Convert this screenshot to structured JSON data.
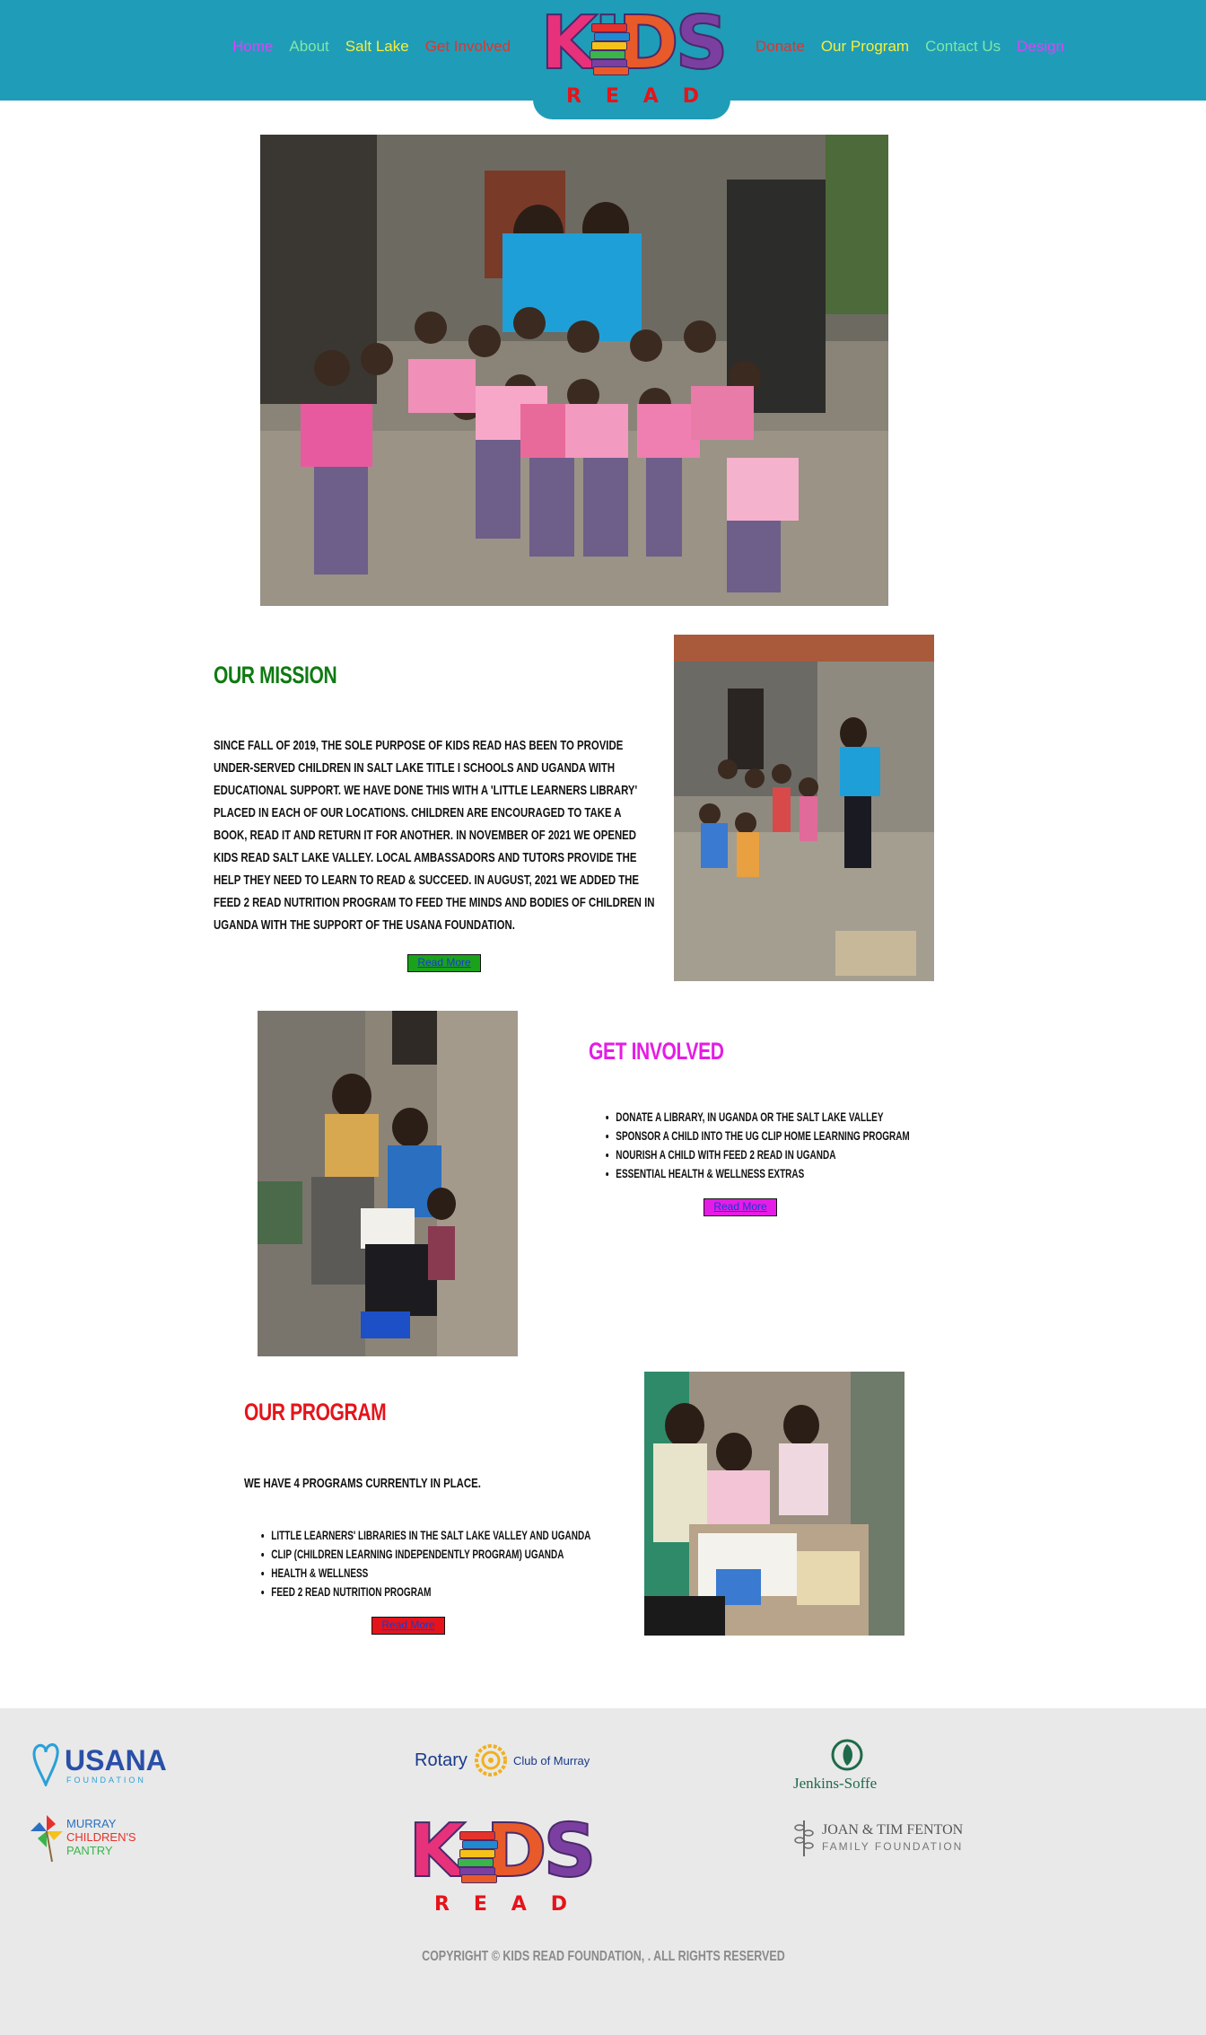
{
  "header": {
    "nav_left": [
      {
        "label": "Home",
        "color": "#e040fb"
      },
      {
        "label": "About",
        "color": "#7ee8a6"
      },
      {
        "label": "Salt Lake",
        "color": "#f5ef3a"
      },
      {
        "label": "Get Involved",
        "color": "#e5322b"
      }
    ],
    "nav_right": [
      {
        "label": "Donate",
        "color": "#e5322b"
      },
      {
        "label": "Our Program",
        "color": "#f5ef3a"
      },
      {
        "label": "Contact Us",
        "color": "#7ee8a6"
      },
      {
        "label": "Design",
        "color": "#e040fb"
      }
    ],
    "logo": {
      "word": "KIDS",
      "sub": "READ",
      "icon": "book-stack-icon"
    }
  },
  "mission": {
    "heading": "OUR MISSION",
    "heading_color": "#0f7a12",
    "text": "Since Fall of 2019, the sole purpose of Kids Read has been to provide under-served children in Salt Lake Title I schools and Uganda with educational support. We have done this with a 'Little Learners Library' placed in each of our locations. Children are encouraged to take a book, read it and return it for another. In November of 2021 we opened Kids Read Salt Lake Valley. Local ambassadors and tutors provide the help they need to learn to read & succeed. In August, 2021 we added the Feed 2 Read nutrition program to feed the minds and bodies of children in Uganda with the support of the USANA Foundation.",
    "button": "Read More",
    "button_color": "#1aa31a"
  },
  "involved": {
    "heading": "GET INVOLVED",
    "heading_color": "#e51ce5",
    "items": [
      "Donate a library, in Uganda or the Salt Lake Valley",
      "Sponsor a child into the UG CLIP Home Learning Program",
      "Nourish a child with Feed 2 Read in Uganda",
      "Essential Health & Wellness Extras"
    ],
    "button": "Read More",
    "button_color": "#e51ce5"
  },
  "program": {
    "heading": "OUR PROGRAM",
    "heading_color": "#e5141a",
    "intro": "We have 4 programs currently in place.",
    "items": [
      "Little Learners' Libraries in the Salt Lake Valley and Uganda",
      "CLIP (Children Learning Independently Program) Uganda",
      "Health & Wellness",
      "Feed 2 Read Nutrition Program"
    ],
    "button": "Read More",
    "button_color": "#e5141a"
  },
  "footer": {
    "sponsors": {
      "usana": {
        "name": "USANA",
        "sub": "FOUNDATION"
      },
      "rotary": {
        "name": "Rotary",
        "sub": "Club of Murray"
      },
      "jenkins": {
        "name": "Jenkins-Soffe"
      },
      "murray": {
        "line1": "MURRAY",
        "line2": "CHILDREN'S",
        "line3": "PANTRY"
      },
      "fenton": {
        "line1": "JOAN & TIM FENTON",
        "line2": "FAMILY FOUNDATION"
      }
    },
    "logo": {
      "word": "KIDS",
      "sub": "READ"
    },
    "copyright": "Copyright © Kids Read Foundation, . All Rights Reserved"
  }
}
